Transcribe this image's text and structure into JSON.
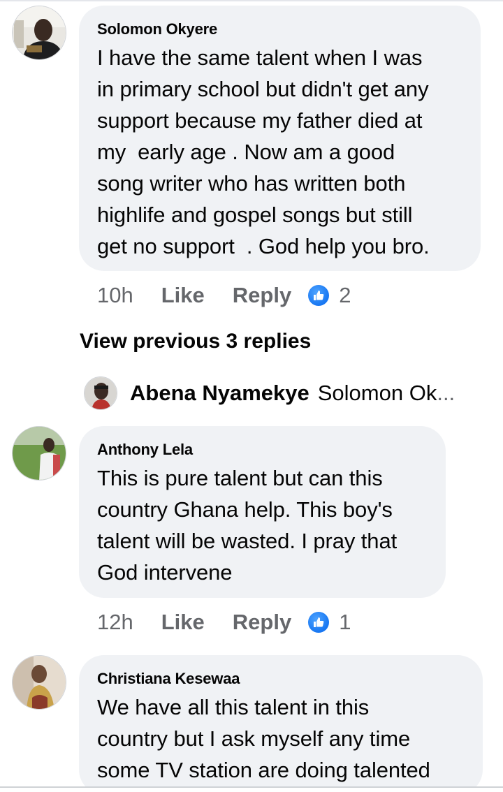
{
  "comments": [
    {
      "author": "Solomon Okyere",
      "text": "I have the same talent when I was\nin primary school but didn't get any\nsupport because my father died at\nmy  early age . Now am a good\nsong writer who has written both\nhighlife and gospel songs but still\nget no support  . God help you bro.",
      "time": "10h",
      "like_label": "Like",
      "reply_label": "Reply",
      "reaction_icon": "thumbs-up-icon",
      "reaction_count": "2"
    },
    {
      "author": "Anthony Lela",
      "text": "This is pure talent but can this\ncountry Ghana help. This boy's\ntalent will be wasted. I pray that\nGod intervene",
      "time": "12h",
      "like_label": "Like",
      "reply_label": "Reply",
      "reaction_icon": "thumbs-up-icon",
      "reaction_count": "1"
    },
    {
      "author": "Christiana Kesewaa",
      "text": "We have all this talent in this\ncountry but I ask myself any time\nsome TV station are doing talented"
    }
  ],
  "thread": {
    "view_previous_label": "View previous 3 replies",
    "latest_reply": {
      "author": "Abena Nyamekye",
      "preview": "Solomon Ok",
      "ellipsis": "..."
    }
  },
  "colors": {
    "bubble": "#f0f2f5",
    "secondary_text": "#65676b",
    "like_blue": "#1877f2"
  }
}
